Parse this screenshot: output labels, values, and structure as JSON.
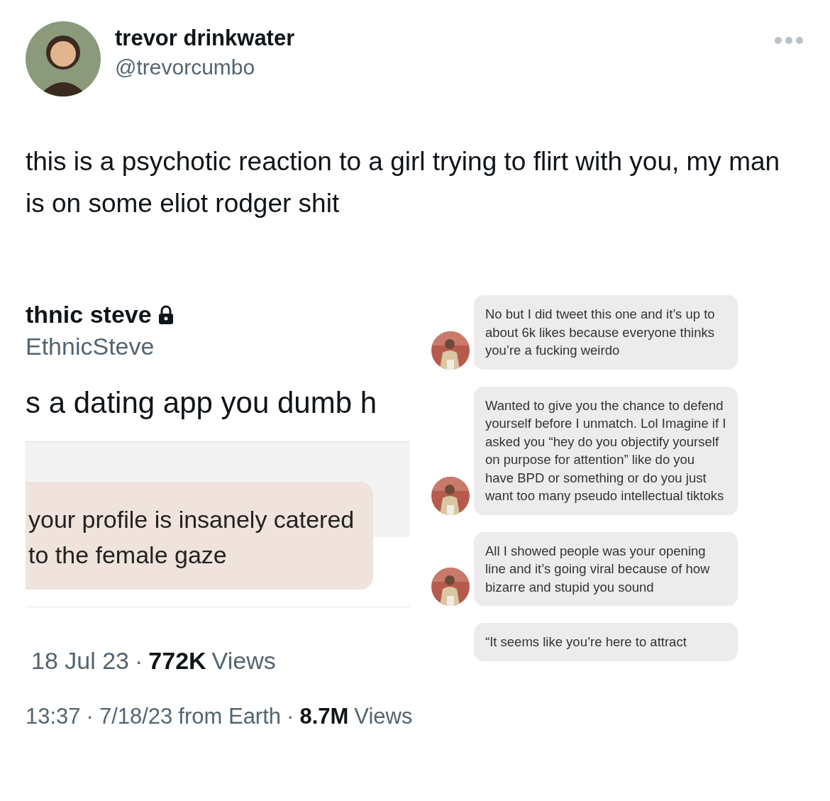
{
  "author": {
    "name": "trevor drinkwater",
    "handle": "@trevorcumbo"
  },
  "text": "this is a psychotic reaction to a girl trying to flirt with you, my man is on some eliot rodger shit",
  "embedded_image": {
    "left": {
      "name": "thnic steve",
      "handle": "EthnicSteve",
      "text": "s a dating app you dumb h",
      "reply_bubble": "your profile is insanely catered to the female gaze",
      "date": "18 Jul 23",
      "separator": "·",
      "views_count": "772K",
      "views_label": "Views"
    },
    "messages": [
      {
        "text": "No but I did tweet this one and it’s up to about 6k likes because everyone thinks you’re a fucking weirdo"
      },
      {
        "text": "Wanted to give you the chance to defend yourself before I unmatch. Lol Imagine if I asked you “hey do you objectify yourself on purpose for attention” like do you have BPD or something or do you just want too many pseudo intellectual tiktoks"
      },
      {
        "text": "All I showed people was your opening line and it’s going viral because of how bizarre and stupid you sound"
      },
      {
        "text": "“It seems like you’re here to attract"
      }
    ]
  },
  "footer": {
    "time": "13:37",
    "separator": "·",
    "date": "7/18/23",
    "source": "from Earth",
    "views_count": "8.7M",
    "views_label": "Views"
  }
}
